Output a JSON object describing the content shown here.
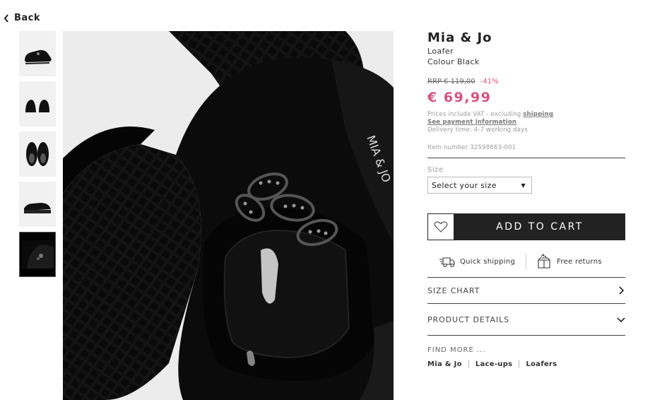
{
  "nav": {
    "back_label": "Back"
  },
  "gallery": {
    "thumbnails": [
      {
        "icon": "shoe-side-thumbnail"
      },
      {
        "icon": "shoe-back-thumbnail"
      },
      {
        "icon": "shoe-top-thumbnail"
      },
      {
        "icon": "shoe-profile-thumbnail"
      },
      {
        "icon": "shoe-detail-thumbnail",
        "active": true
      }
    ]
  },
  "product": {
    "brand": "Mia & Jo",
    "type": "Loafer",
    "colour": "Colour Black",
    "rrp": "RRP € 119,00",
    "discount": "-41%",
    "price": "€ 69,99",
    "vat_text": "Prices include VAT - excluding",
    "vat_link": "shipping",
    "payment_link": "See payment information",
    "delivery": "Delivery time: 4-7 working days",
    "item_number": "Item number 32598663-001"
  },
  "size": {
    "label": "Size",
    "placeholder": "Select your size"
  },
  "actions": {
    "add_to_cart": "ADD TO CART"
  },
  "services": {
    "quick_shipping": "Quick shipping",
    "free_returns": "Free returns"
  },
  "accordion": {
    "size_chart": "SIZE CHART",
    "product_details": "PRODUCT DETAILS"
  },
  "find_more": {
    "title": "FIND MORE ...",
    "links": [
      "Mia & Jo",
      "Lace-ups",
      "Loafers"
    ]
  },
  "colors": {
    "accent": "#d5547e",
    "dark": "#222222"
  }
}
